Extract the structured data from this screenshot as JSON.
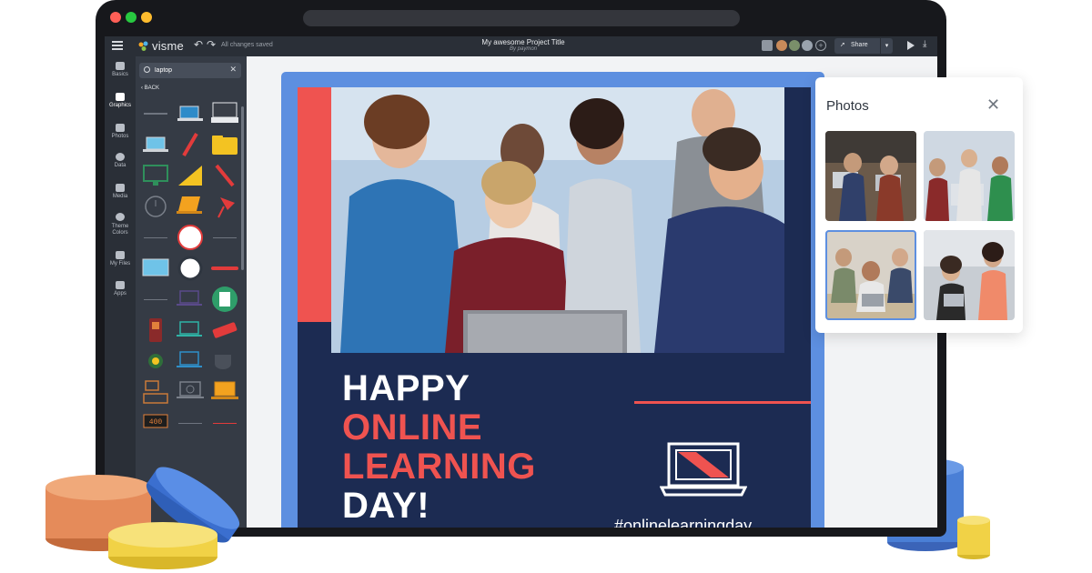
{
  "topbar": {
    "logo": "visme",
    "saved_status": "All changes saved",
    "project_title": "My awesome Project Title",
    "project_by": "By paymon",
    "share_label": "Share",
    "undo_icon": "undo-icon",
    "redo_icon": "redo-icon"
  },
  "rail": {
    "items": [
      {
        "label": "Basics",
        "icon": "basics-icon"
      },
      {
        "label": "Graphics",
        "icon": "graphics-icon"
      },
      {
        "label": "Photos",
        "icon": "photos-icon"
      },
      {
        "label": "Data",
        "icon": "data-icon"
      },
      {
        "label": "Media",
        "icon": "media-icon"
      },
      {
        "label": "Theme Colors",
        "icon": "theme-colors-icon"
      },
      {
        "label": "My Files",
        "icon": "my-files-icon"
      },
      {
        "label": "Apps",
        "icon": "apps-icon"
      }
    ],
    "active": "Graphics"
  },
  "panel": {
    "search_value": "laptop",
    "back_label": "BACK"
  },
  "design": {
    "line1": "HAPPY",
    "line2": "ONLINE",
    "line3": "LEARNING",
    "line4": "DAY!",
    "hashtag": "#onlinelearningday"
  },
  "photos_panel": {
    "title": "Photos",
    "close_icon": "close-icon"
  },
  "colors": {
    "accent_red": "#ef5350",
    "navy": "#1c2b52",
    "border_blue": "#5d8fe0",
    "ui_dark": "#2a2f37"
  }
}
